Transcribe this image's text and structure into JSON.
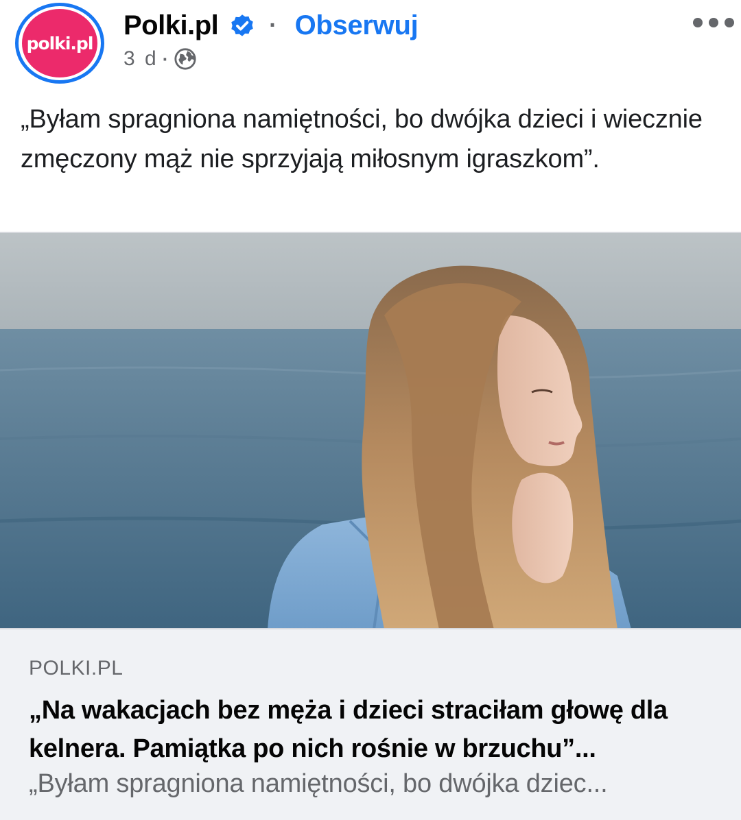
{
  "post": {
    "page_name": "Polki.pl",
    "avatar_text": "polki.pl",
    "follow_label": "Obserwuj",
    "separator": "·",
    "time": "3 d",
    "meta_separator": "·",
    "caption": "„Byłam spragniona namiętności, bo dwójka dzieci i wiecznie zmęczony mąż nie sprzyjają miłosnym igraszkom”."
  },
  "link_preview": {
    "domain": "POLKI.PL",
    "title": "„Na wakacjach bez męża i dzieci straciłam głowę dla kelnera. Pamiątka po nich rośnie w brzuchu”...",
    "description": "„Byłam spragniona namiętności, bo dwójka dziec..."
  },
  "icons": {
    "verified": "verified-badge-icon",
    "audience": "globe-icon",
    "more": "more-options-icon"
  },
  "colors": {
    "accent": "#1877f2",
    "brand": "#ec2a6b",
    "muted": "#65676b",
    "preview_bg": "#f0f2f5"
  }
}
